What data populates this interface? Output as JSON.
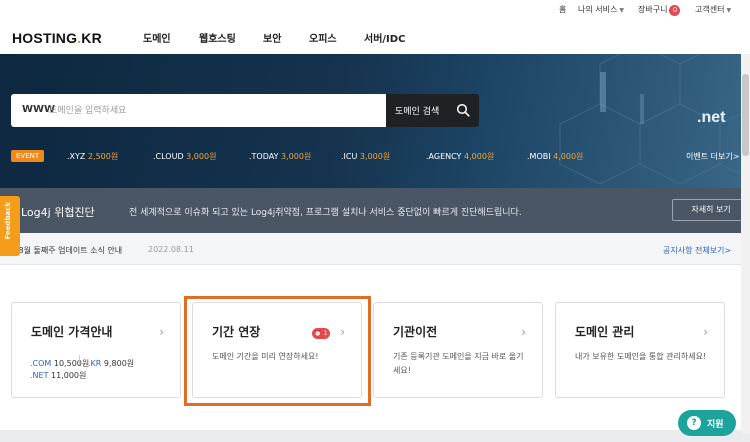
{
  "utility": {
    "home": "홈",
    "my_service": "나의 서비스",
    "cart": "장바구니",
    "cart_count": "0",
    "support": "고객센터"
  },
  "logo": {
    "text": "HOSTING",
    "dot": ".",
    "suffix": "KR"
  },
  "nav": [
    "도메인",
    "웹호스팅",
    "보안",
    "오피스",
    "서버/IDC"
  ],
  "search": {
    "prefix": "WWW",
    "placeholder": "도메인을 입력하세요",
    "value": "",
    "button": "도메인 검색",
    "button_icon": "search-icon"
  },
  "hero": {
    "watermark": ".net"
  },
  "event": {
    "badge": "EVENT",
    "tlds": [
      {
        "name": ".XYZ",
        "price": "2,500원"
      },
      {
        "name": ".CLOUD",
        "price": "3,000원"
      },
      {
        "name": ".TODAY",
        "price": "3,000원"
      },
      {
        "name": ".ICU",
        "price": "3,000원"
      },
      {
        "name": ".AGENCY",
        "price": "4,000원"
      },
      {
        "name": ".MOBI",
        "price": "4,000원"
      }
    ],
    "more": "이벤트 더보기>"
  },
  "security": {
    "title": "Log4j 위협진단",
    "desc": "전 세계적으로 이슈화 되고 있는 Log4j취약점, 프로그램 설치나 서비스 중단없이 빠르게 진단해드립니다.",
    "button": "자세히 보기"
  },
  "notice": {
    "text": "[공지] 8월 둘째주 업데이트 소식 안내",
    "date": "2022.08.11",
    "more": "공지사항 전체보기>"
  },
  "cards": [
    {
      "title": "도메인 가격안내",
      "prices": [
        {
          "tld": ".COM",
          "price": "10,500원"
        },
        {
          "tld": ".KR",
          "price": "9,800원"
        },
        {
          "tld": ".NET",
          "price": "11,000원"
        }
      ]
    },
    {
      "title": "기간 연장",
      "badge": "1",
      "desc": "도메인 기간을 미리 연장하세요!"
    },
    {
      "title": "기관이전",
      "desc": "기존 등록기관 도메인을 지금 바로 옮기세요!"
    },
    {
      "title": "도메인 관리",
      "desc": "내가 보유한 도메인을 통합 관리하세요!"
    }
  ],
  "feedback": "Feedback",
  "support_button": "지원",
  "colors": {
    "accent_orange": "#f08a1c",
    "highlight_orange": "#e06f24",
    "teal": "#1ba39c",
    "link_blue": "#2b63c8",
    "badge_red": "#e5484d"
  }
}
